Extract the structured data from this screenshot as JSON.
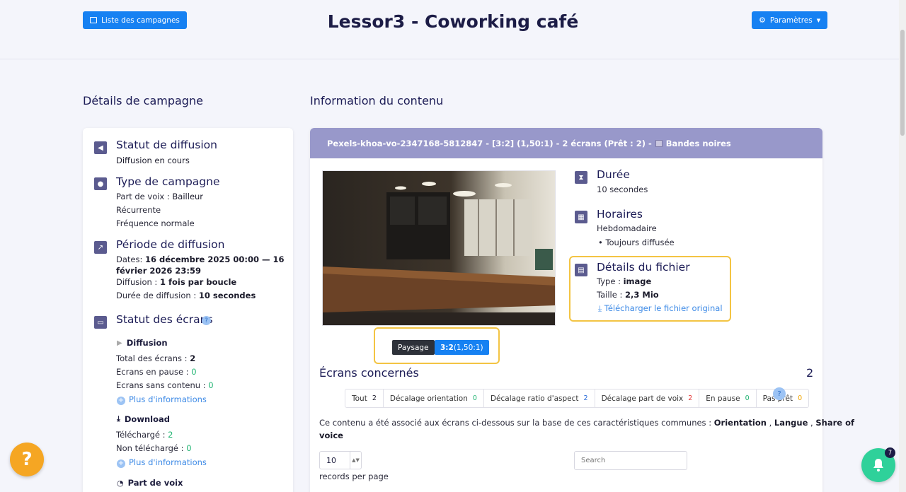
{
  "topbar": {
    "campaign_list_label": "Liste des campagnes",
    "title": "Lessor3 - Coworking café",
    "settings_label": "Paramètres"
  },
  "left": {
    "section_title": "Détails de campagne",
    "broadcast_status": {
      "title": "Statut de diffusion",
      "value": "Diffusion en cours"
    },
    "campaign_type": {
      "title": "Type de campagne",
      "share_label": "Part de voix : ",
      "share_value": "Bailleur",
      "recurrence": "Récurrente",
      "frequency": "Fréquence normale"
    },
    "period": {
      "title": "Période de diffusion",
      "dates_label": "Dates: ",
      "dates_value_1": "16 décembre 2025 00:00 — 16",
      "dates_value_2": "février 2026 23:59",
      "diffusion_label": "Diffusion : ",
      "diffusion_value": "1 fois par boucle",
      "duration_label": "Durée de diffusion : ",
      "duration_value": "10 secondes"
    },
    "screens_status": {
      "title": "Statut des écrans",
      "help": "?",
      "diffusion_header": "Diffusion",
      "total_label": "Total des écrans : ",
      "total_value": "2",
      "paused_label": "Ecrans en pause : ",
      "paused_value": "0",
      "no_content_label": "Ecrans sans contenu : ",
      "no_content_value": "0",
      "more_info_1": "Plus d'informations",
      "download_header": "Download",
      "downloaded_label": "Téléchargé : ",
      "downloaded_value": "2",
      "not_downloaded_label": "Non téléchargé : ",
      "not_downloaded_value": "0",
      "more_info_2": "Plus d'informations",
      "share_header": "Part de voix"
    }
  },
  "right": {
    "section_title": "Information du contenu",
    "header": "Pexels-khoa-vo-2347168-5812847 - [3:2] (1,50:1) - 2 écrans (Prêt : 2) -",
    "header_tail": "Bandes noires",
    "orientation_pill": "Paysage",
    "ratio_bold": "3:2",
    "ratio_rest": " (1,50:1)",
    "duration": {
      "title": "Durée",
      "value": "10 secondes"
    },
    "schedule": {
      "title": "Horaires",
      "value": "Hebdomadaire",
      "bullet": "Toujours diffusée"
    },
    "file": {
      "title": "Détails du fichier",
      "type_label": "Type : ",
      "type_value": "image",
      "size_label": "Taille : ",
      "size_value": "2,3 Mio",
      "download_link": "Télécharger le fichier original"
    },
    "screens": {
      "title": "Écrans concernés",
      "count": "2",
      "help": "?",
      "tabs": [
        {
          "label": "Tout",
          "count": "2"
        },
        {
          "label": "Décalage orientation",
          "count": "0"
        },
        {
          "label": "Décalage ratio d'aspect",
          "count": "2"
        },
        {
          "label": "Décalage part de voix",
          "count": "2"
        },
        {
          "label": "En pause",
          "count": "0"
        },
        {
          "label": "Pas prêt",
          "count": "0"
        }
      ],
      "description_start": "Ce contenu a été associé aux écrans ci-dessous sur la base de ces caractéristiques communes : ",
      "char_1": "Orientation",
      "char_2": "Langue",
      "char_3": "Share of",
      "char_3b": "voice",
      "records_value": "10",
      "records_label": "records per page",
      "search_placeholder": "Search"
    }
  },
  "fab": {
    "help": "?",
    "notifications_count": "7"
  }
}
